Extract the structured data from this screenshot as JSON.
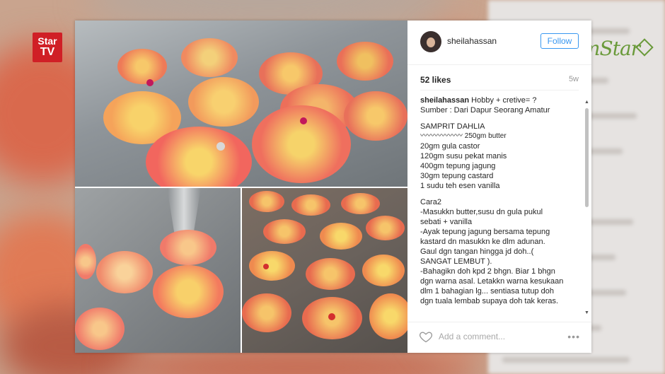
{
  "channel_logo": {
    "line1": "Star",
    "line2": "TV"
  },
  "partner_logo": "mStar",
  "post": {
    "username": "sheilahassan",
    "follow_label": "Follow",
    "likes": "52 likes",
    "age": "5w",
    "caption_user": "sheilahassan",
    "caption_lines": [
      "Hobby + cretive= ?",
      "Sumber : Dari Dapur Seorang Amatur",
      "",
      "SAMPRIT DAHLIA",
      "〰〰〰〰〰〰 250gm butter",
      "20gm gula castor",
      "120gm susu pekat manis",
      "400gm tepung jagung",
      "30gm tepung castard",
      "1 sudu teh esen vanilla",
      "",
      "Cara2",
      "-Masukkn butter,susu dn gula pukul",
      "sebati + vanilla",
      "-Ayak tepung jagung bersama tepung",
      "kastard dn masukkn ke dlm adunan.",
      "Gaul dgn tangan hingga jd doh..(",
      "SANGAT LEMBUT ).",
      "-Bahagikn doh kpd 2 bhgn. Biar 1 bhgn",
      "dgn warna asal. Letakkn warna kesukaan",
      "dlm 1 bahagian lg... sentiasa tutup doh",
      "dgn tuala lembab supaya doh tak keras."
    ],
    "comment_placeholder": "Add a comment...",
    "more_label": "•••"
  },
  "icons": {
    "heart": "heart-icon",
    "scroll_up": "scroll-up-icon",
    "scroll_down": "scroll-down-icon"
  },
  "colors": {
    "follow_blue": "#3897f0",
    "startv_red": "#d01f26",
    "mstar_green": "#6a9a3a"
  }
}
